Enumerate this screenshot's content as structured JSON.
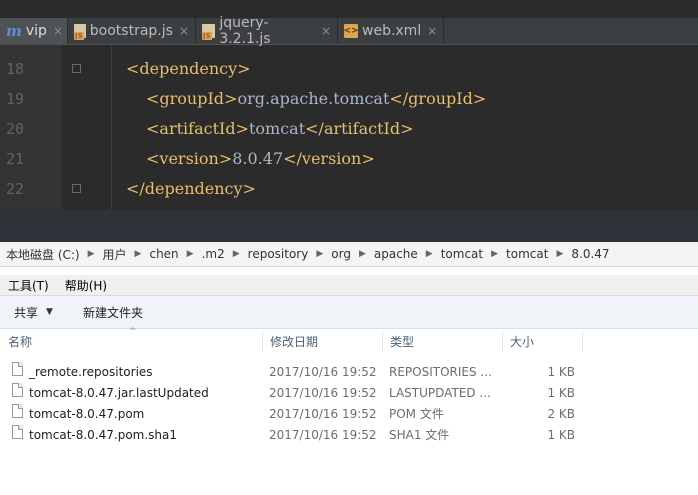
{
  "editor": {
    "tabs": [
      {
        "label": "vip",
        "icon": "maven-m-icon",
        "active": true
      },
      {
        "label": "bootstrap.js",
        "icon": "js-file-icon",
        "active": false
      },
      {
        "label": "jquery-3.2.1.js",
        "icon": "js-file-icon",
        "active": false
      },
      {
        "label": "web.xml",
        "icon": "xml-file-icon",
        "active": false
      }
    ],
    "tab_close": "×",
    "lines": [
      {
        "num": "18",
        "open": "<dependency>",
        "text": "",
        "close": ""
      },
      {
        "num": "19",
        "open": "<groupId>",
        "text": "org.apache.tomcat",
        "close": "</groupId>"
      },
      {
        "num": "20",
        "open": "<artifactId>",
        "text": "tomcat",
        "close": "</artifactId>"
      },
      {
        "num": "21",
        "open": "<version>",
        "text": "8.0.47",
        "close": "</version>"
      },
      {
        "num": "22",
        "open": "</dependency>",
        "text": "",
        "close": ""
      }
    ],
    "colors": {
      "tag": "#e8bf6a",
      "text": "#a9b7c6",
      "background": "#2b2b2b"
    }
  },
  "explorer": {
    "breadcrumb": [
      "本地磁盘 (C:)",
      "用户",
      "chen",
      ".m2",
      "repository",
      "org",
      "apache",
      "tomcat",
      "tomcat",
      "8.0.47"
    ],
    "breadcrumb_sep": "▶",
    "menu": [
      "工具(T)",
      "帮助(H)"
    ],
    "commands": {
      "share": "共享",
      "share_caret": "▼",
      "new_folder": "新建文件夹"
    },
    "columns": {
      "name": "名称",
      "modified": "修改日期",
      "type": "类型",
      "size": "大小",
      "sort_indicator": "^"
    },
    "files": [
      {
        "name": "_remote.repositories",
        "modified": "2017/10/16 19:52",
        "type": "REPOSITORIES ...",
        "size": "1 KB"
      },
      {
        "name": "tomcat-8.0.47.jar.lastUpdated",
        "modified": "2017/10/16 19:52",
        "type": "LASTUPDATED ...",
        "size": "1 KB"
      },
      {
        "name": "tomcat-8.0.47.pom",
        "modified": "2017/10/16 19:52",
        "type": "POM 文件",
        "size": "2 KB"
      },
      {
        "name": "tomcat-8.0.47.pom.sha1",
        "modified": "2017/10/16 19:52",
        "type": "SHA1 文件",
        "size": "1 KB"
      }
    ]
  }
}
